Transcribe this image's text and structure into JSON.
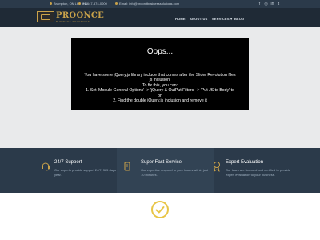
{
  "topbar": {
    "address": "Brampton, ON L6X 5N1",
    "phone": "+1-647-574-0000",
    "email": "Email: info@proonitbusinesssolutions.com",
    "social_icons": [
      "facebook-icon",
      "instagram-icon",
      "linkedin-icon",
      "twitter-icon"
    ]
  },
  "header": {
    "logo_word": "PROONCE",
    "logo_sub": "BUSINESS SOLUTIONS",
    "nav": [
      "HOME",
      "ABOUT US",
      "SERVICES",
      "BLOG"
    ],
    "nav_caret": "▾"
  },
  "error": {
    "title": "Oops...",
    "lines": [
      "You have some jQuery.js library include that comes after the Slider Revolution files",
      "js inclusion.",
      "To fix this, you can:",
      "1. Set 'Module General Options' -> 'jQuery & OutPut Filters' -> 'Put JS to Body' to",
      "on",
      "2. Find the double jQuery.js inclusion and remove it"
    ]
  },
  "features": [
    {
      "icon": "support-icon",
      "title": "24/7 Support",
      "desc": "Our experts provide support 24/7, 365 days a year."
    },
    {
      "icon": "speed-icon",
      "title": "Super Fast Service",
      "desc": "Our expertise respond to your issues within just 10 minutes."
    },
    {
      "icon": "award-icon",
      "title": "Expert Evaluation",
      "desc": "Our team are licensed and certified to provide expert evaluation to your business."
    }
  ],
  "colors": {
    "accent": "#c9a24a",
    "topbar": "#2b3a4a",
    "header": "#1f2a36",
    "features": "#2b3a4a",
    "check": "#e8c547"
  },
  "bottom": {
    "icon": "check-circle-icon"
  }
}
